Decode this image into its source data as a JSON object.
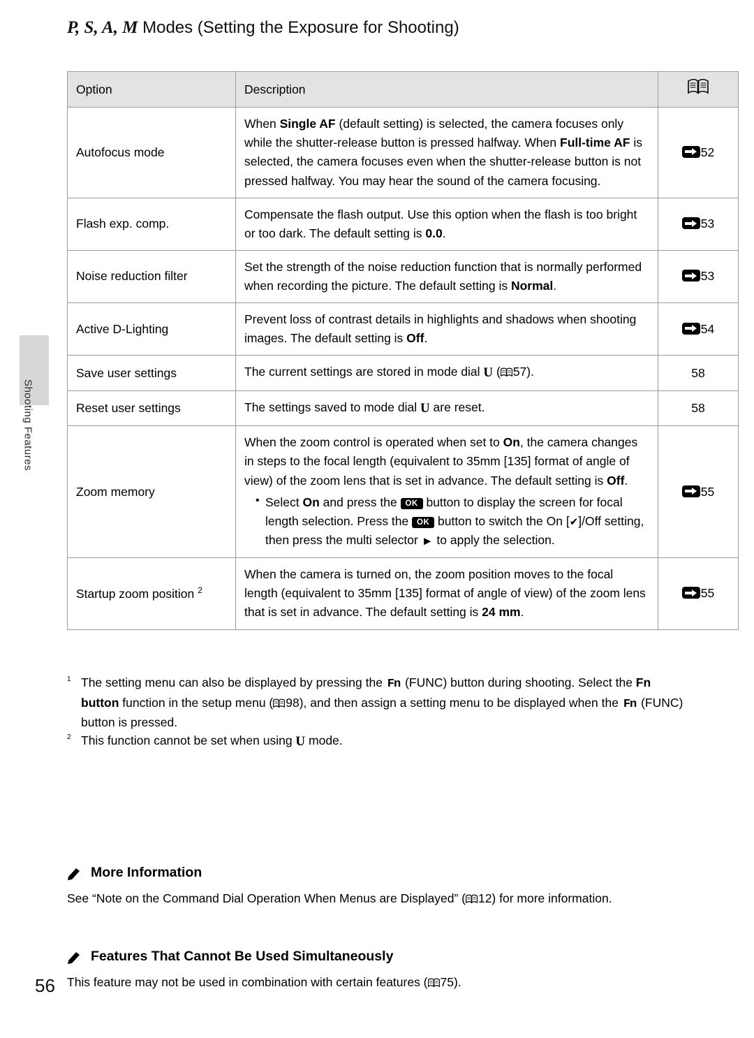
{
  "page": {
    "number": "56",
    "side_tab_label": "Shooting Features",
    "title_symbols": "P, S, A, M",
    "title_rest": " Modes (Setting the Exposure for Shooting)"
  },
  "table": {
    "headers": {
      "option": "Option",
      "description": "Description",
      "ref": "book-icon"
    },
    "rows": [
      {
        "option": "Autofocus mode",
        "desc_html": "When <span class=\"b\">Single AF</span> (default setting) is selected, the camera focuses only while the shutter-release button is pressed halfway. When <span class=\"b\">Full-time AF</span> is selected, the camera focuses even when the shutter-release button is not pressed halfway. You may hear the sound of the camera focusing.",
        "ref": "52",
        "ref_type": "emark"
      },
      {
        "option": "Flash exp. comp.",
        "desc_html": "Compensate the flash output. Use this option when the flash is too bright or too dark. The default setting is <span class=\"b\">0.0</span>.",
        "ref": "53",
        "ref_type": "emark"
      },
      {
        "option": "Noise reduction filter",
        "desc_html": "Set the strength of the noise reduction function that is normally performed when recording the picture. The default setting is <span class=\"b\">Normal</span>.",
        "ref": "53",
        "ref_type": "emark"
      },
      {
        "option": "Active D-Lighting",
        "desc_html": "Prevent loss of contrast details in highlights and shadows when shooting images. The default setting is <span class=\"b\">Off</span>.",
        "ref": "54",
        "ref_type": "emark"
      },
      {
        "option": "Save user settings",
        "desc_html": "The current settings are stored in mode dial <span class=\"udial\">U</span> (<span class=\"book\"></span>57).",
        "ref": "58",
        "ref_type": "plain"
      },
      {
        "option": "Reset user settings",
        "desc_html": "The settings saved to mode dial <span class=\"udial\">U</span> are reset.",
        "ref": "58",
        "ref_type": "plain"
      },
      {
        "option": "Zoom memory",
        "desc_html": "When the zoom control is operated when set to <span class=\"b\">On</span>, the camera changes in steps to the focal length (equivalent to 35mm [135] format of angle of view) of the zoom lens that is set in advance. The default setting is <span class=\"b\">Off</span>.",
        "bullets": [
          "Select <span class=\"b\">On</span> and press the <span class=\"okbtn\">OK</span> button to display the screen for focal length selection. Press the <span class=\"okbtn\">OK</span> button to switch the On [<span class=\"check-glyph\">&#10004;</span>]/Off setting, then press the multi selector <span class=\"arrow-right\">&#9658;</span> to apply the selection."
        ],
        "ref": "55",
        "ref_type": "emark"
      },
      {
        "option": "Startup zoom position",
        "option_sup": "2",
        "desc_html": "When the camera is turned on, the zoom position moves to the focal length (equivalent to 35mm [135] format of angle of view) of the zoom lens that is set in advance. The default setting is <span class=\"b\">24 mm</span>.",
        "ref": "55",
        "ref_type": "emark"
      }
    ]
  },
  "footnotes": [
    {
      "num": "1",
      "html": "The setting menu can also be displayed by pressing the <span class=\"fnbtn\">Fn</span> (FUNC) button during shooting. Select the <span class=\"b\">Fn button</span> function in the setup menu (<span class=\"book\"></span>98), and then assign a setting menu to be displayed when the <span class=\"fnbtn\">Fn</span> (FUNC) button is pressed."
    },
    {
      "num": "2",
      "html": "This function cannot be set when using <span class=\"udial\">U</span> mode."
    }
  ],
  "sections": [
    {
      "heading": "More Information",
      "body_html": "See “Note on the Command Dial Operation When Menus are Displayed” (<span class=\"book\"></span>12) for more information."
    },
    {
      "heading": "Features That Cannot Be Used Simultaneously",
      "body_html": "This feature may not be used in combination with certain features (<span class=\"book\"></span>75)."
    }
  ]
}
